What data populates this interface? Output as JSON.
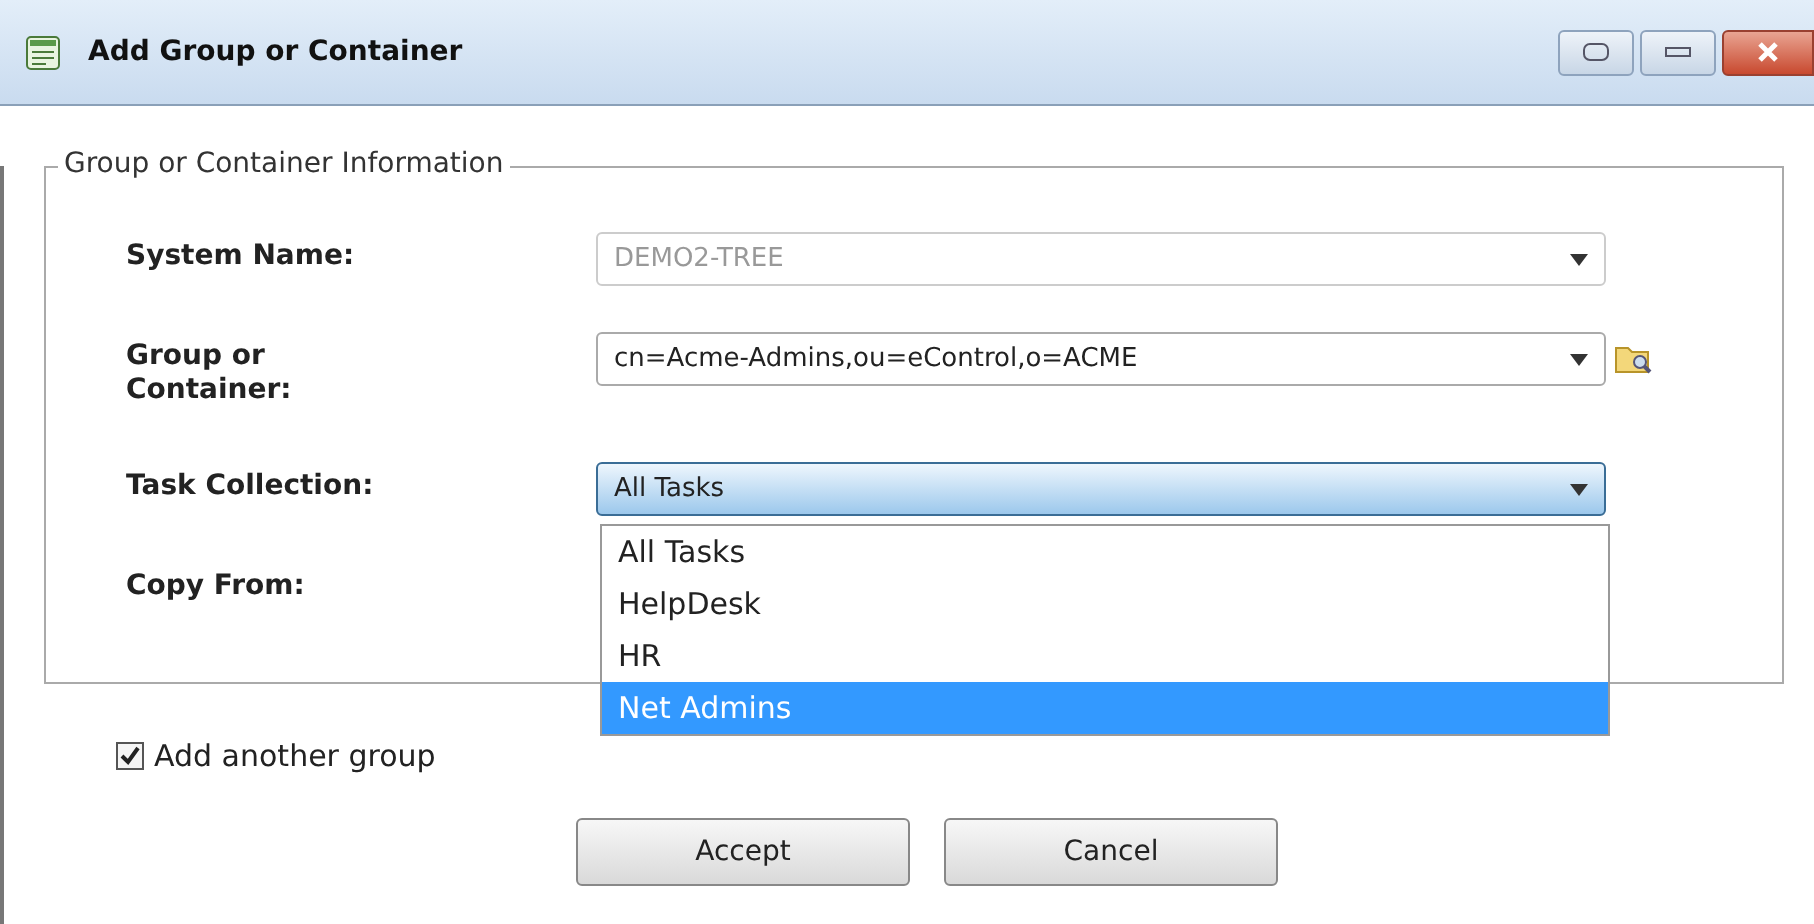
{
  "window": {
    "title": "Add Group or Container"
  },
  "group_box": {
    "legend": "Group or Container Information",
    "fields": [
      {
        "label": "System Name:",
        "value": "DEMO2-TREE",
        "disabled": true,
        "focused": false
      },
      {
        "label": "Group or Container:",
        "value": "cn=Acme-Admins,ou=eControl,o=ACME",
        "disabled": false,
        "focused": false,
        "browse": true
      },
      {
        "label": "Task Collection:",
        "value": "All Tasks",
        "disabled": false,
        "focused": true
      },
      {
        "label": "Copy From:"
      }
    ]
  },
  "dropdown": {
    "options": [
      {
        "label": "All Tasks",
        "selected": false
      },
      {
        "label": "HelpDesk",
        "selected": false
      },
      {
        "label": "HR",
        "selected": false
      },
      {
        "label": "Net Admins",
        "selected": true
      }
    ]
  },
  "add_another": {
    "label": "Add another group",
    "checked": true
  },
  "buttons": [
    "Accept",
    "Cancel"
  ]
}
